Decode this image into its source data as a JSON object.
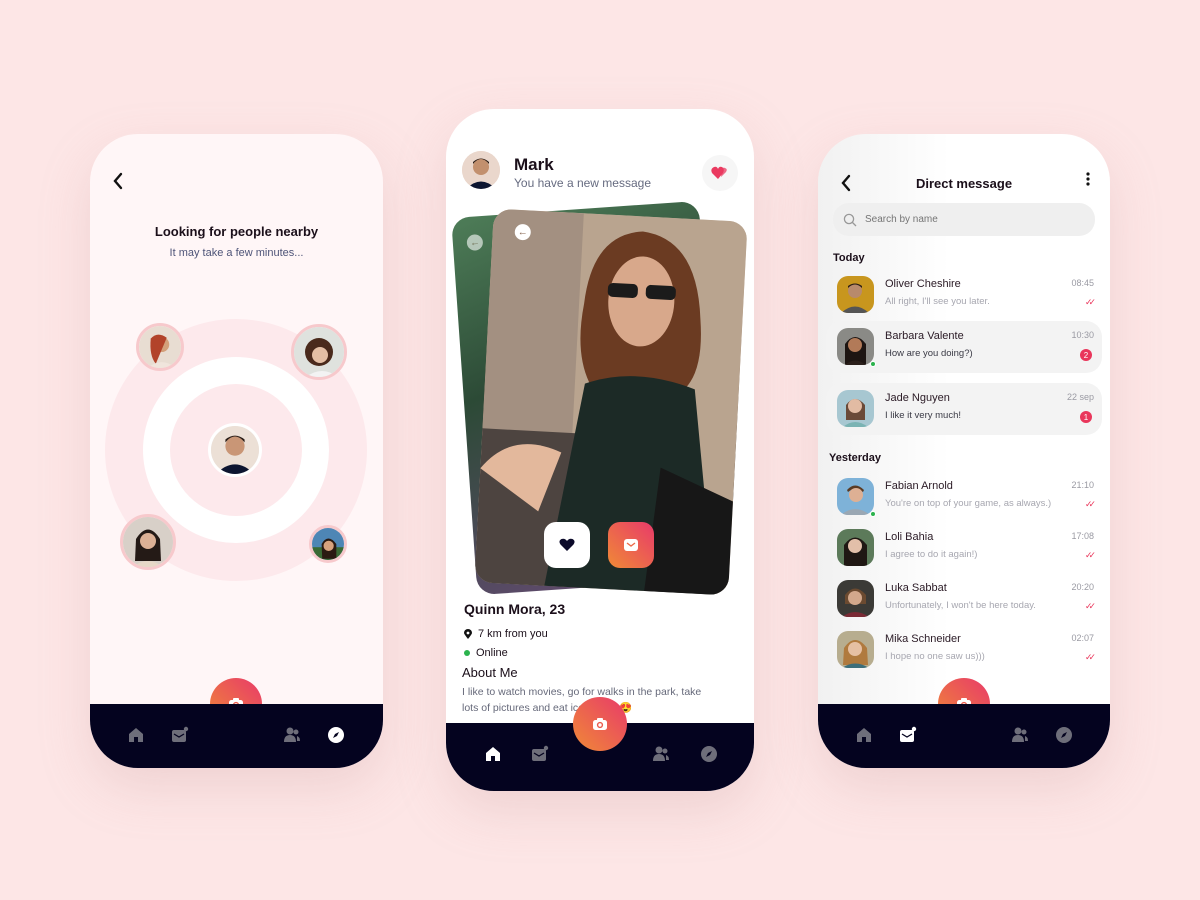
{
  "colors": {
    "background": "#fde6e6",
    "navbar": "#04031f",
    "accent_gradient_start": "#e83a6a",
    "accent_gradient_end": "#f08a36",
    "badge": "#e9365b",
    "online": "#2bb34d"
  },
  "nearby": {
    "back_icon": "chevron-left-icon",
    "title": "Looking for people nearby",
    "subtitle": "It may take a few minutes...",
    "nav": {
      "items": [
        "home",
        "mail",
        "people",
        "explore"
      ],
      "active": "explore"
    }
  },
  "profile": {
    "header": {
      "name": "Mark",
      "subtitle": "You have a new message",
      "action_icon": "hearts-icon"
    },
    "card": {
      "back_arrow": "←",
      "like_icon": "heart-icon",
      "message_icon": "mail-icon"
    },
    "name": "Quinn Mora, 23",
    "distance": "7 km from you",
    "status": "Online",
    "about_heading": "About Me",
    "about_text": "I like to watch movies, go for walks in the park, take lots of pictures and eat ice cream 😍",
    "nav": {
      "items": [
        "home",
        "mail",
        "people",
        "explore"
      ],
      "active": "home"
    }
  },
  "messages": {
    "title": "Direct message",
    "search": {
      "placeholder": "Search by name",
      "value": ""
    },
    "sections": [
      {
        "label": "Today",
        "items": [
          {
            "name": "Oliver Cheshire",
            "message": "All right, I'll see you later.",
            "time": "08:45",
            "status": "read",
            "highlight": false,
            "online": false
          },
          {
            "name": "Barbara Valente",
            "message": "How are you doing?)",
            "time": "10:30",
            "unread": "2",
            "highlight": true,
            "online": true
          },
          {
            "name": "Jade Nguyen",
            "message": "I like it very much!",
            "time": "22 sep",
            "unread": "1",
            "highlight": true,
            "online": false
          }
        ]
      },
      {
        "label": "Yesterday",
        "items": [
          {
            "name": "Fabian Arnold",
            "message": "You're on top of your game, as always.)",
            "time": "21:10",
            "status": "read",
            "highlight": false,
            "online": true
          },
          {
            "name": "Loli Bahia",
            "message": "I agree to do it again!)",
            "time": "17:08",
            "status": "read",
            "highlight": false,
            "online": false
          },
          {
            "name": "Luka Sabbat",
            "message": "Unfortunately, I won't be here today.",
            "time": "20:20",
            "status": "read",
            "highlight": false,
            "online": false
          },
          {
            "name": "Mika Schneider",
            "message": "I hope no one saw us)))",
            "time": "02:07",
            "status": "read",
            "highlight": false,
            "online": false
          }
        ]
      }
    ],
    "read_tick": "✓✓",
    "nav": {
      "items": [
        "home",
        "mail",
        "people",
        "explore"
      ],
      "active": "mail"
    }
  }
}
